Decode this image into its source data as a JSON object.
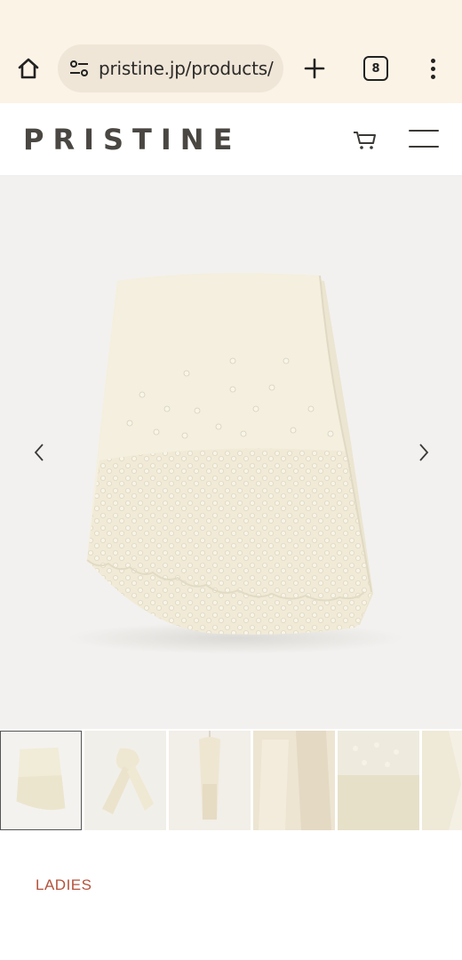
{
  "browser": {
    "url": "pristine.jp/products/",
    "tab_count": "8",
    "icons": [
      "home-icon",
      "site-settings-icon",
      "new-tab-icon",
      "tab-switcher-icon",
      "more-options-icon"
    ]
  },
  "site": {
    "logo": "PRISTINE",
    "icons": [
      "cart-icon",
      "hamburger-menu-icon"
    ]
  },
  "gallery": {
    "icons": [
      "chevron-left-icon",
      "chevron-right-icon"
    ],
    "thumbnail_count": 6,
    "active_thumbnail": 1
  },
  "product": {
    "category": "LADIES"
  },
  "colors": {
    "chrome_bg": "#fbf3e6",
    "gallery_bg": "#f2f1ef",
    "knit": "#f3eedd",
    "accent": "#b5523b",
    "logo": "#4a4743"
  }
}
